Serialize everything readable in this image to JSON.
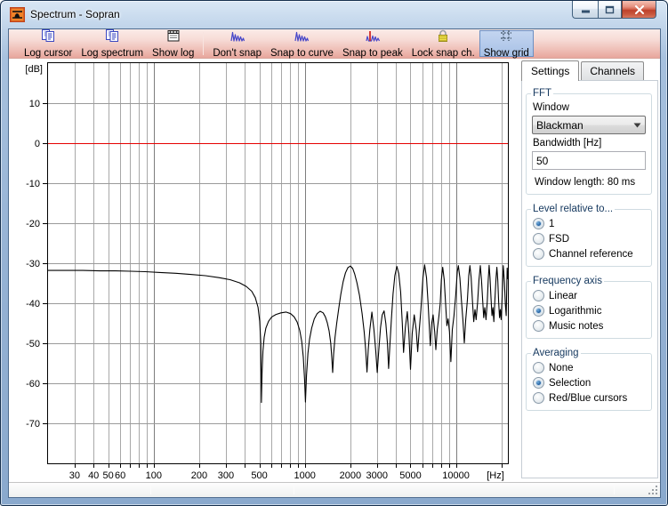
{
  "window": {
    "title": "Spectrum - Sopran"
  },
  "caption_buttons": {
    "minimize": "minimize",
    "maximize": "maximize",
    "close": "close"
  },
  "toolbar": {
    "buttons": [
      {
        "label": "Log cursor",
        "icon": "copy-log-icon",
        "active": false,
        "sep_after": false
      },
      {
        "label": "Log spectrum",
        "icon": "copy-log-icon",
        "active": false,
        "sep_after": false
      },
      {
        "label": "Show log",
        "icon": "notepad-icon",
        "active": false,
        "sep_after": true
      },
      {
        "label": "Don't snap",
        "icon": "spectrum-icon",
        "active": false,
        "sep_after": false
      },
      {
        "label": "Snap to curve",
        "icon": "spectrum-icon",
        "active": false,
        "sep_after": false
      },
      {
        "label": "Snap to peak",
        "icon": "spectrum-peak-icon",
        "active": false,
        "sep_after": false
      },
      {
        "label": "Lock snap ch.",
        "icon": "lock-icon",
        "active": false,
        "sep_after": false
      },
      {
        "label": "Show grid",
        "icon": "grid-icon",
        "active": true,
        "sep_after": false
      }
    ]
  },
  "panel": {
    "tabs": [
      {
        "label": "Settings",
        "active": true
      },
      {
        "label": "Channels",
        "active": false
      }
    ],
    "fft": {
      "title": "FFT",
      "window_label": "Window",
      "window_value": "Blackman",
      "bandwidth_label": "Bandwidth [Hz]",
      "bandwidth_value": "50",
      "window_length": "Window length: 80 ms"
    },
    "level": {
      "title": "Level relative to...",
      "options": [
        "1",
        "FSD",
        "Channel reference"
      ],
      "selected": "1"
    },
    "freq_axis": {
      "title": "Frequency axis",
      "options": [
        "Linear",
        "Logarithmic",
        "Music notes"
      ],
      "selected": "Logarithmic"
    },
    "averaging": {
      "title": "Averaging",
      "options": [
        "None",
        "Selection",
        "Red/Blue cursors"
      ],
      "selected": "Selection"
    }
  },
  "colors": {
    "zero_line": "#e60000",
    "curve": "#000000",
    "grid_minor": "#a8a8a8",
    "grid_major": "#7d7d7d",
    "toolbar_active": "#a8c1e6"
  },
  "chart_data": {
    "type": "line",
    "title": "",
    "x_axis": {
      "label": "[Hz]",
      "scale": "log",
      "min": 20,
      "max": 22050,
      "labeled_ticks": [
        30,
        40,
        50,
        60,
        100,
        200,
        300,
        500,
        1000,
        2000,
        3000,
        5000,
        10000
      ]
    },
    "y_axis": {
      "label": "[dB]",
      "min": -80,
      "max": 20,
      "tick_step": 10,
      "labeled_ticks": [
        10,
        0,
        -10,
        -20,
        -30,
        -40,
        -50,
        -60,
        -70
      ]
    },
    "zero_line_db": 0,
    "grid": true,
    "series": [
      {
        "name": "spectrum",
        "color": "#000000",
        "points": [
          [
            20,
            -31.8
          ],
          [
            26,
            -31.8
          ],
          [
            34,
            -31.8
          ],
          [
            44,
            -31.9
          ],
          [
            56,
            -31.9
          ],
          [
            70,
            -32.0
          ],
          [
            88,
            -32.1
          ],
          [
            110,
            -32.3
          ],
          [
            140,
            -32.5
          ],
          [
            175,
            -32.8
          ],
          [
            220,
            -33.1
          ],
          [
            270,
            -33.6
          ],
          [
            320,
            -34.1
          ],
          [
            370,
            -34.9
          ],
          [
            410,
            -35.8
          ],
          [
            445,
            -37.0
          ],
          [
            470,
            -38.6
          ],
          [
            490,
            -41.0
          ],
          [
            503,
            -44.5
          ],
          [
            511,
            -50.0
          ],
          [
            516,
            -64.8
          ],
          [
            521,
            -57.5
          ],
          [
            528,
            -52.0
          ],
          [
            538,
            -48.5
          ],
          [
            552,
            -46.2
          ],
          [
            575,
            -44.5
          ],
          [
            605,
            -43.4
          ],
          [
            645,
            -42.8
          ],
          [
            695,
            -42.4
          ],
          [
            750,
            -42.2
          ],
          [
            805,
            -42.6
          ],
          [
            850,
            -43.4
          ],
          [
            890,
            -44.7
          ],
          [
            925,
            -46.8
          ],
          [
            953,
            -49.5
          ],
          [
            977,
            -53.5
          ],
          [
            996,
            -59.0
          ],
          [
            1010,
            -64.7
          ],
          [
            1026,
            -58.0
          ],
          [
            1048,
            -52.5
          ],
          [
            1075,
            -49.0
          ],
          [
            1110,
            -46.2
          ],
          [
            1155,
            -43.9
          ],
          [
            1205,
            -42.6
          ],
          [
            1262,
            -42.0
          ],
          [
            1322,
            -42.4
          ],
          [
            1368,
            -43.4
          ],
          [
            1408,
            -44.9
          ],
          [
            1448,
            -46.9
          ],
          [
            1483,
            -49.9
          ],
          [
            1507,
            -53.5
          ],
          [
            1527,
            -57.3
          ],
          [
            1552,
            -52.6
          ],
          [
            1583,
            -48.6
          ],
          [
            1627,
            -44.9
          ],
          [
            1677,
            -41.2
          ],
          [
            1732,
            -37.7
          ],
          [
            1792,
            -34.6
          ],
          [
            1857,
            -32.4
          ],
          [
            1927,
            -31.1
          ],
          [
            2002,
            -30.7
          ],
          [
            2072,
            -31.3
          ],
          [
            2137,
            -32.7
          ],
          [
            2212,
            -34.9
          ],
          [
            2302,
            -38.1
          ],
          [
            2392,
            -42.6
          ],
          [
            2467,
            -47.1
          ],
          [
            2527,
            -51.6
          ],
          [
            2578,
            -57.2
          ],
          [
            2627,
            -51.6
          ],
          [
            2692,
            -46.6
          ],
          [
            2778,
            -42.2
          ],
          [
            2867,
            -46.6
          ],
          [
            2947,
            -52.1
          ],
          [
            3012,
            -57.3
          ],
          [
            3087,
            -51.6
          ],
          [
            3167,
            -46.1
          ],
          [
            3252,
            -42.9
          ],
          [
            3342,
            -41.9
          ],
          [
            3437,
            -45.1
          ],
          [
            3522,
            -50.1
          ],
          [
            3582,
            -56.3
          ],
          [
            3652,
            -50.6
          ],
          [
            3737,
            -44.1
          ],
          [
            3832,
            -37.6
          ],
          [
            3942,
            -33.1
          ],
          [
            4062,
            -30.8
          ],
          [
            4182,
            -32.6
          ],
          [
            4302,
            -37.1
          ],
          [
            4412,
            -45.1
          ],
          [
            4502,
            -52.3
          ],
          [
            4622,
            -46.1
          ],
          [
            4762,
            -42.1
          ],
          [
            4882,
            -47.6
          ],
          [
            5002,
            -56.5
          ],
          [
            5132,
            -47.6
          ],
          [
            5292,
            -42.9
          ],
          [
            5452,
            -46.6
          ],
          [
            5582,
            -52.1
          ],
          [
            5702,
            -47.1
          ],
          [
            5862,
            -41.6
          ],
          [
            6042,
            -33.6
          ],
          [
            6202,
            -30.4
          ],
          [
            6382,
            -33.6
          ],
          [
            6542,
            -40.1
          ],
          [
            6652,
            -45.6
          ],
          [
            6762,
            -50.6
          ],
          [
            6902,
            -45.1
          ],
          [
            7052,
            -42.9
          ],
          [
            7232,
            -47.1
          ],
          [
            7362,
            -51.6
          ],
          [
            7522,
            -46.6
          ],
          [
            7702,
            -43.3
          ],
          [
            7862,
            -40.1
          ],
          [
            8002,
            -34.1
          ],
          [
            8172,
            -31.0
          ],
          [
            8352,
            -34.1
          ],
          [
            8552,
            -40.6
          ],
          [
            8702,
            -45.6
          ],
          [
            8872,
            -43.9
          ],
          [
            9052,
            -47.1
          ],
          [
            9252,
            -54.6
          ],
          [
            9452,
            -46.6
          ],
          [
            9702,
            -43.1
          ],
          [
            9952,
            -38.1
          ],
          [
            10202,
            -32.1
          ],
          [
            10372,
            -30.6
          ],
          [
            10602,
            -33.6
          ],
          [
            10852,
            -39.1
          ],
          [
            11102,
            -44.1
          ],
          [
            11352,
            -49.9
          ],
          [
            11602,
            -44.1
          ],
          [
            11902,
            -39.1
          ],
          [
            12152,
            -33.1
          ],
          [
            12362,
            -30.6
          ],
          [
            12602,
            -33.6
          ],
          [
            12852,
            -39.6
          ],
          [
            13102,
            -44.6
          ],
          [
            13352,
            -41.6
          ],
          [
            13602,
            -44.1
          ],
          [
            13902,
            -39.6
          ],
          [
            14202,
            -34.1
          ],
          [
            14482,
            -30.6
          ],
          [
            14752,
            -34.1
          ],
          [
            15002,
            -39.1
          ],
          [
            15252,
            -43.6
          ],
          [
            15502,
            -41.1
          ],
          [
            15802,
            -44.1
          ],
          [
            16102,
            -39.6
          ],
          [
            16352,
            -34.1
          ],
          [
            16562,
            -30.5
          ],
          [
            16802,
            -33.6
          ],
          [
            17052,
            -38.6
          ],
          [
            17302,
            -43.1
          ],
          [
            17552,
            -41.1
          ],
          [
            17802,
            -44.6
          ],
          [
            18102,
            -39.1
          ],
          [
            18402,
            -33.6
          ],
          [
            18642,
            -31.0
          ],
          [
            18902,
            -34.1
          ],
          [
            19152,
            -39.6
          ],
          [
            19402,
            -43.6
          ],
          [
            19652,
            -41.6
          ],
          [
            19902,
            -44.1
          ],
          [
            20202,
            -38.6
          ],
          [
            20562,
            -30.6
          ],
          [
            20902,
            -34.6
          ],
          [
            21202,
            -40.1
          ],
          [
            21502,
            -43.1
          ],
          [
            21802,
            -31.2
          ],
          [
            22050,
            -34.0
          ]
        ]
      }
    ]
  }
}
